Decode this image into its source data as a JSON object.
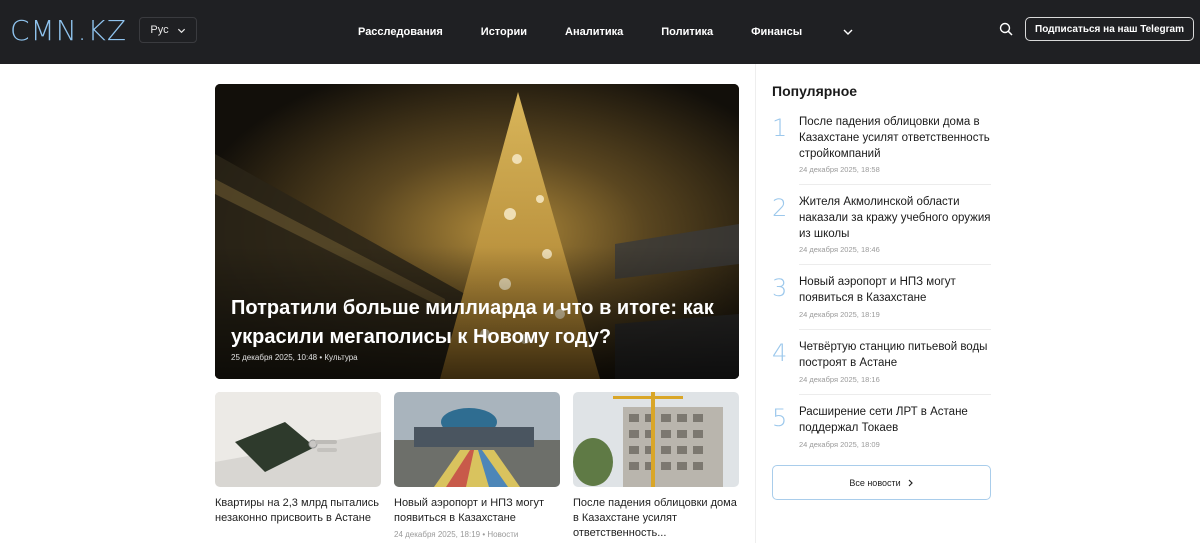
{
  "header": {
    "logo": "CMN.KZ",
    "language": "Рус",
    "nav": [
      "Расследования",
      "Истории",
      "Аналитика",
      "Политика",
      "Финансы"
    ],
    "subscribe_label": "Подписаться на наш Telegram"
  },
  "hero": {
    "title": "Потратили больше миллиарда и что в итоге: как украсили мегаполисы к Новому году?",
    "meta": "25 декабря 2025, 10:48 • Культура"
  },
  "cards": [
    {
      "title": "Квартиры на 2,3 млрд пытались незаконно присвоить в Астане",
      "meta": ""
    },
    {
      "title": "Новый аэропорт и НПЗ могут появиться в Казахстане",
      "meta": "24 декабря 2025, 18:19 • Новости"
    },
    {
      "title": "После падения облицовки дома в Казахстане усилят ответственность...",
      "meta": ""
    }
  ],
  "popular": {
    "heading": "Популярное",
    "items": [
      {
        "num": "1",
        "title": "После падения облицовки дома в Казахстане усилят ответственность стройкомпаний",
        "date": "24 декабря 2025, 18:58"
      },
      {
        "num": "2",
        "title": "Жителя Акмолинской области наказали за кражу учебного оружия из школы",
        "date": "24 декабря 2025, 18:46"
      },
      {
        "num": "3",
        "title": "Новый аэропорт и НПЗ могут появиться в Казахстане",
        "date": "24 декабря 2025, 18:19"
      },
      {
        "num": "4",
        "title": "Четвёртую станцию питьевой воды построят в Астане",
        "date": "24 декабря 2025, 18:16"
      },
      {
        "num": "5",
        "title": "Расширение сети ЛРТ в Астане поддержал Токаев",
        "date": "24 декабря 2025, 18:09"
      }
    ],
    "all_news_label": "Все новости"
  },
  "colors": {
    "header_bg": "#1f2023",
    "accent": "#8fc3ee",
    "number": "#9cc8ec"
  }
}
